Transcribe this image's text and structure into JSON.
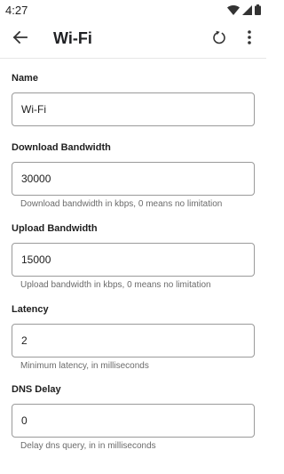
{
  "status_bar": {
    "time": "4:27"
  },
  "app_bar": {
    "title": "Wi-Fi"
  },
  "fields": [
    {
      "label": "Name",
      "value": "Wi-Fi",
      "help": ""
    },
    {
      "label": "Download Bandwidth",
      "value": "30000",
      "help": "Download bandwidth in kbps, 0 means no limitation"
    },
    {
      "label": "Upload Bandwidth",
      "value": "15000",
      "help": "Upload bandwidth in kbps, 0 means no limitation"
    },
    {
      "label": "Latency",
      "value": "2",
      "help": "Minimum latency, in milliseconds"
    },
    {
      "label": "DNS Delay",
      "value": "0",
      "help": "Delay dns query, in in milliseconds"
    }
  ]
}
